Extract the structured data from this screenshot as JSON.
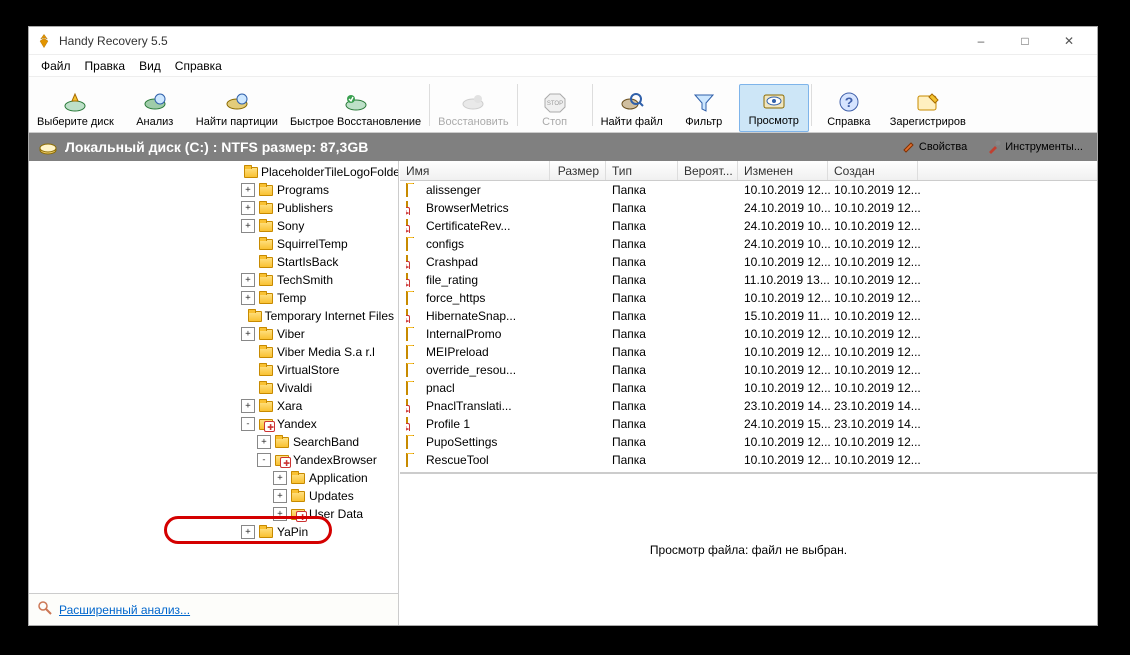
{
  "window": {
    "title": "Handy Recovery 5.5",
    "minimize": "–",
    "maximize": "□",
    "close": "✕"
  },
  "menubar": {
    "file": "Файл",
    "edit": "Правка",
    "view": "Вид",
    "help": "Справка"
  },
  "toolbar": {
    "select_disk": "Выберите диск",
    "analyze": "Анализ",
    "find_part": "Найти партиции",
    "quick_recover": "Быстрое Восстановление",
    "recover": "Восстановить",
    "stop": "Стоп",
    "find_file": "Найти файл",
    "filter": "Фильтр",
    "preview": "Просмотр",
    "help": "Справка",
    "register": "Зарегистриров"
  },
  "disk_bar": {
    "label": "Локальный диск (C:) : NTFS размер: 87,3GB",
    "props": "Свойства",
    "tools": "Инструменты..."
  },
  "tree": {
    "items": [
      {
        "depth": 7,
        "exp": "",
        "icon": "fld",
        "label": "PlaceholderTileLogoFolder"
      },
      {
        "depth": 7,
        "exp": "+",
        "icon": "fld",
        "label": "Programs"
      },
      {
        "depth": 7,
        "exp": "+",
        "icon": "fld",
        "label": "Publishers"
      },
      {
        "depth": 7,
        "exp": "+",
        "icon": "fld",
        "label": "Sony"
      },
      {
        "depth": 7,
        "exp": "",
        "icon": "fld",
        "label": "SquirrelTemp"
      },
      {
        "depth": 7,
        "exp": "",
        "icon": "fld",
        "label": "StartIsBack"
      },
      {
        "depth": 7,
        "exp": "+",
        "icon": "fld",
        "label": "TechSmith"
      },
      {
        "depth": 7,
        "exp": "+",
        "icon": "fld",
        "label": "Temp"
      },
      {
        "depth": 7,
        "exp": "",
        "icon": "fld",
        "label": "Temporary Internet Files"
      },
      {
        "depth": 7,
        "exp": "+",
        "icon": "fld",
        "label": "Viber"
      },
      {
        "depth": 7,
        "exp": "",
        "icon": "fld",
        "label": "Viber Media S.a r.l"
      },
      {
        "depth": 7,
        "exp": "",
        "icon": "fld",
        "label": "VirtualStore"
      },
      {
        "depth": 7,
        "exp": "",
        "icon": "fld",
        "label": "Vivaldi"
      },
      {
        "depth": 7,
        "exp": "+",
        "icon": "fld",
        "label": "Xara"
      },
      {
        "depth": 7,
        "exp": "-",
        "icon": "fld-del",
        "label": "Yandex"
      },
      {
        "depth": 8,
        "exp": "+",
        "icon": "fld",
        "label": "SearchBand"
      },
      {
        "depth": 8,
        "exp": "-",
        "icon": "fld-del",
        "label": "YandexBrowser"
      },
      {
        "depth": 9,
        "exp": "+",
        "icon": "fld",
        "label": "Application"
      },
      {
        "depth": 9,
        "exp": "+",
        "icon": "fld",
        "label": "Updates"
      },
      {
        "depth": 9,
        "exp": "+",
        "icon": "fld-del",
        "label": "User Data"
      },
      {
        "depth": 7,
        "exp": "+",
        "icon": "fld",
        "label": "YaPin"
      }
    ],
    "advanced": "Расширенный анализ..."
  },
  "columns": {
    "name": "Имя",
    "size": "Размер",
    "type": "Тип",
    "prob": "Вероят...",
    "modified": "Изменен",
    "created": "Создан"
  },
  "col_widths": {
    "name": 150,
    "size": 56,
    "type": 72,
    "prob": 60,
    "modified": 90,
    "created": 90
  },
  "files": [
    {
      "icon": "fld",
      "name": "alissenger",
      "type": "Папка",
      "modified": "10.10.2019 12...",
      "created": "10.10.2019 12..."
    },
    {
      "icon": "fld-del",
      "name": "BrowserMetrics",
      "type": "Папка",
      "modified": "24.10.2019 10...",
      "created": "10.10.2019 12..."
    },
    {
      "icon": "fld-del",
      "name": "CertificateRev...",
      "type": "Папка",
      "modified": "24.10.2019 10...",
      "created": "10.10.2019 12..."
    },
    {
      "icon": "fld",
      "name": "configs",
      "type": "Папка",
      "modified": "24.10.2019 10...",
      "created": "10.10.2019 12..."
    },
    {
      "icon": "fld-del",
      "name": "Crashpad",
      "type": "Папка",
      "modified": "10.10.2019 12...",
      "created": "10.10.2019 12..."
    },
    {
      "icon": "fld-del",
      "name": "file_rating",
      "type": "Папка",
      "modified": "11.10.2019 13...",
      "created": "10.10.2019 12..."
    },
    {
      "icon": "fld",
      "name": "force_https",
      "type": "Папка",
      "modified": "10.10.2019 12...",
      "created": "10.10.2019 12..."
    },
    {
      "icon": "fld-del",
      "name": "HibernateSnap...",
      "type": "Папка",
      "modified": "15.10.2019 11...",
      "created": "10.10.2019 12..."
    },
    {
      "icon": "fld",
      "name": "InternalPromo",
      "type": "Папка",
      "modified": "10.10.2019 12...",
      "created": "10.10.2019 12..."
    },
    {
      "icon": "fld",
      "name": "MEIPreload",
      "type": "Папка",
      "modified": "10.10.2019 12...",
      "created": "10.10.2019 12..."
    },
    {
      "icon": "fld",
      "name": "override_resou...",
      "type": "Папка",
      "modified": "10.10.2019 12...",
      "created": "10.10.2019 12..."
    },
    {
      "icon": "fld",
      "name": "pnacl",
      "type": "Папка",
      "modified": "10.10.2019 12...",
      "created": "10.10.2019 12..."
    },
    {
      "icon": "fld-del",
      "name": "PnaclTranslati...",
      "type": "Папка",
      "modified": "23.10.2019 14...",
      "created": "23.10.2019 14..."
    },
    {
      "icon": "fld-del",
      "name": "Profile 1",
      "type": "Папка",
      "modified": "24.10.2019 15...",
      "created": "23.10.2019 14..."
    },
    {
      "icon": "fld",
      "name": "PupoSettings",
      "type": "Папка",
      "modified": "10.10.2019 12...",
      "created": "10.10.2019 12..."
    },
    {
      "icon": "fld",
      "name": "RescueTool",
      "type": "Папка",
      "modified": "10.10.2019 12...",
      "created": "10.10.2019 12..."
    }
  ],
  "preview": {
    "text": "Просмотр файла: файл не выбран."
  }
}
